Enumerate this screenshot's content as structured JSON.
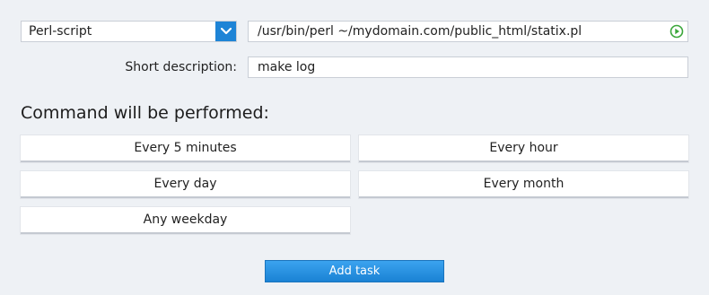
{
  "script_type": {
    "selected": "Perl-script",
    "icon": "chevron-down-icon",
    "accent": "#1e84d6"
  },
  "command": {
    "value": "/usr/bin/perl ~/mydomain.com/public_html/statix.pl",
    "run_icon": "play-icon",
    "run_color": "#3aa63a"
  },
  "description": {
    "label": "Short description:",
    "value": "make log"
  },
  "schedule": {
    "heading": "Command will be performed:",
    "options": [
      "Every 5 minutes",
      "Every hour",
      "Every day",
      "Every month",
      "Any weekday"
    ]
  },
  "actions": {
    "add_task": "Add task"
  }
}
